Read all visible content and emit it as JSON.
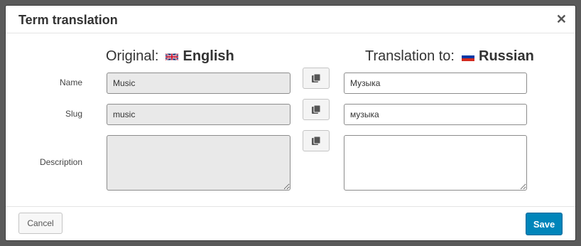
{
  "dialog": {
    "title": "Term translation",
    "close_icon": "close-icon",
    "close_glyph": "✕"
  },
  "original": {
    "label": "Original:",
    "language": "English",
    "flag_icon": "uk-flag-icon"
  },
  "translation": {
    "label": "Translation to:",
    "language": "Russian",
    "flag_icon": "russia-flag-icon"
  },
  "rows": {
    "name": {
      "label": "Name",
      "original": "Music",
      "translated": "Музыка"
    },
    "slug": {
      "label": "Slug",
      "original": "music",
      "translated": "музыка"
    },
    "description": {
      "label": "Description",
      "original": "",
      "translated": ""
    }
  },
  "copy_icon": "copy-icon",
  "footer": {
    "cancel_label": "Cancel",
    "save_label": "Save"
  },
  "colors": {
    "save_bg": "#0085ba",
    "readonly_bg": "#e9e9e9"
  }
}
